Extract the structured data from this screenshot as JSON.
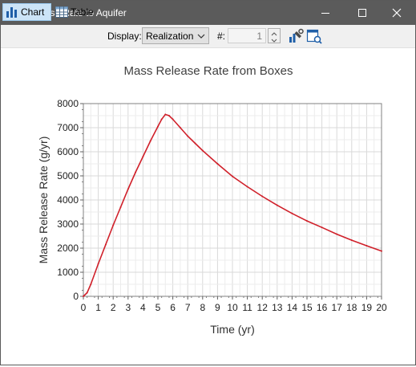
{
  "window": {
    "title": "Release Rate to Aquifer"
  },
  "toolbar": {
    "chart_label": "Chart",
    "table_label": "Table",
    "display_label": "Display:",
    "display_value": "Realization",
    "realization_label": "#:",
    "realization_value": "1"
  },
  "colors": {
    "titlebar": "#5b5b5b",
    "series": "#d0202a",
    "grid": "#d9d9d9",
    "active_button": "#cce4f7"
  },
  "icons": [
    "bar-chart-icon",
    "table-icon",
    "minimize-icon",
    "maximize-icon",
    "close-icon",
    "chevron-down-icon",
    "spin-up-icon",
    "spin-down-icon",
    "chart-properties-icon",
    "chart-settings-icon"
  ],
  "chart_data": {
    "type": "line",
    "title": "Mass Release Rate from Boxes",
    "xlabel": "Time (yr)",
    "ylabel": "Mass Release Rate (g/yr)",
    "xlim": [
      0,
      20
    ],
    "ylim": [
      0,
      8000
    ],
    "xticks": [
      "0",
      "1",
      "2",
      "3",
      "4",
      "5",
      "6",
      "7",
      "8",
      "9",
      "10",
      "11",
      "12",
      "13",
      "14",
      "15",
      "16",
      "17",
      "18",
      "19",
      "20"
    ],
    "yticks": [
      "0",
      "1000",
      "2000",
      "3000",
      "4000",
      "5000",
      "6000",
      "7000",
      "8000"
    ],
    "grid": true,
    "legend": "none",
    "series": [
      {
        "x": [
          0,
          0.25,
          0.5,
          1,
          1.5,
          2,
          2.5,
          3,
          3.5,
          4,
          4.5,
          5,
          5.25,
          5.5,
          5.75,
          6,
          6.5,
          7,
          7.5,
          8,
          9,
          10,
          11,
          12,
          13,
          14,
          15,
          16,
          17,
          18,
          19,
          20
        ],
        "values": [
          0,
          150,
          500,
          1350,
          2150,
          2950,
          3700,
          4450,
          5150,
          5800,
          6450,
          7050,
          7350,
          7550,
          7500,
          7350,
          7000,
          6650,
          6350,
          6050,
          5500,
          4980,
          4550,
          4150,
          3780,
          3440,
          3130,
          2860,
          2580,
          2330,
          2100,
          1880
        ]
      }
    ]
  }
}
